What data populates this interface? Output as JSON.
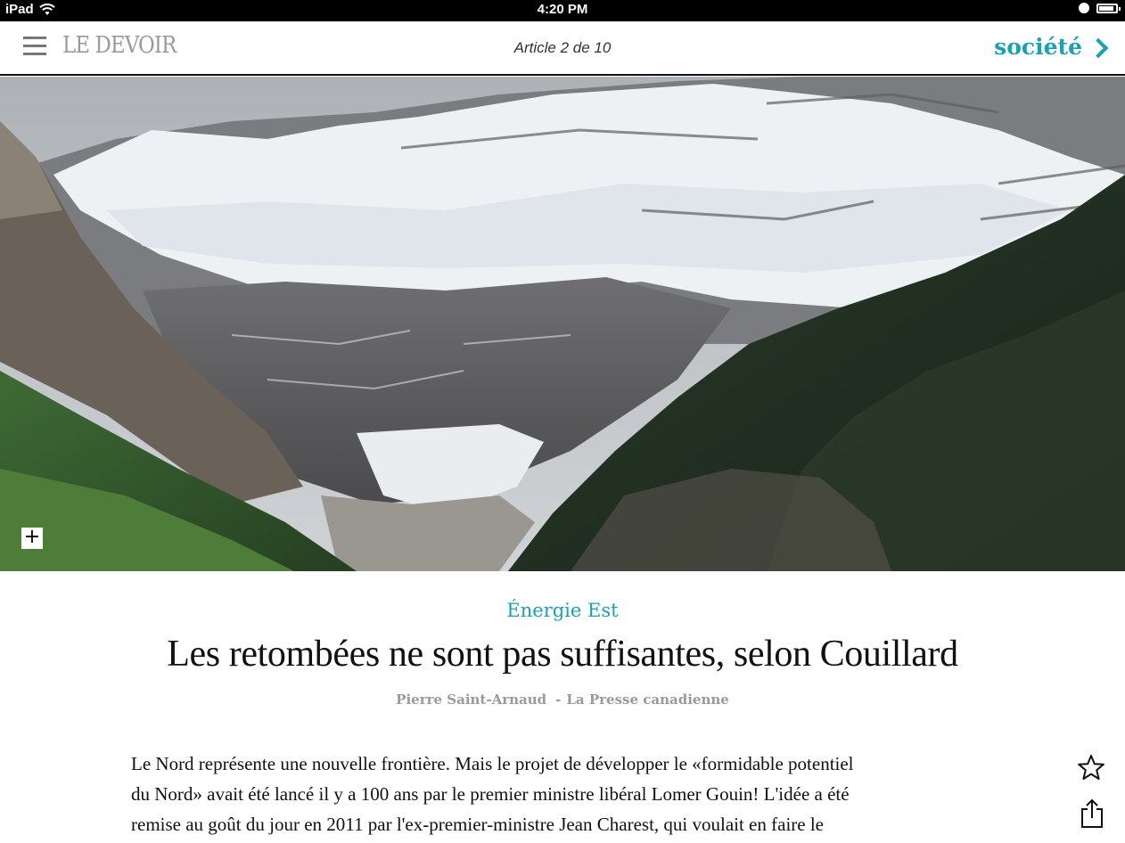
{
  "status_bar": {
    "device": "iPad",
    "time": "4:20 PM",
    "battery_level": 0.9
  },
  "nav": {
    "logo": "LE DEVOIR",
    "article_counter": "Article 2 de 10",
    "section_label": "société"
  },
  "hero": {
    "expand_label": "+"
  },
  "article": {
    "kicker": "Énergie Est",
    "title": "Les retombées ne sont pas suffisantes, selon Couillard",
    "author": "Pierre Saint-Arnaud",
    "source_separator": "-",
    "source": "La Presse canadienne",
    "body_lines": [
      "Le Nord représente une nouvelle frontière. Mais le projet de développer le «formidable potentiel",
      "du Nord» avait été lancé il y a 100 ans par le premier ministre libéral Lomer Gouin! L'idée a été",
      "remise au goût du jour en 2011 par l'ex-premier-ministre Jean Charest, qui voulait en faire le"
    ]
  },
  "colors": {
    "accent": "#1aa1b3",
    "muted": "#9a9a9a"
  },
  "icons": [
    "wifi-icon",
    "lock-icon",
    "battery-icon",
    "hamburger-icon",
    "chevron-right-icon",
    "plus-icon",
    "star-icon",
    "share-icon"
  ]
}
